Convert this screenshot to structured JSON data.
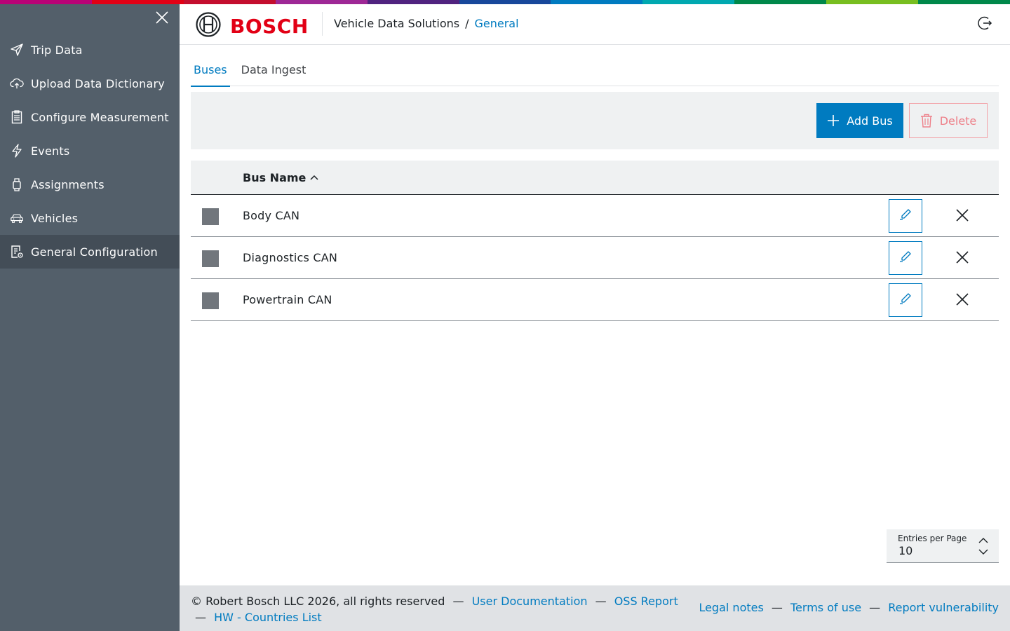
{
  "colors": {
    "accent": "#007bc0",
    "brand_red": "#e20015",
    "sidebar_bg": "#535f6a",
    "sidebar_active": "#434d57",
    "rainbow": [
      "#b90276",
      "#e20015",
      "#c40e2e",
      "#9e2896",
      "#50237f",
      "#18489b",
      "#007bc0",
      "#00a8b0",
      "#00884a",
      "#78be20",
      "#00884a"
    ]
  },
  "sidebar": {
    "close_icon": "close-icon",
    "items": [
      {
        "label": "Trip Data",
        "icon": "send-icon",
        "active": false
      },
      {
        "label": "Upload Data Dictionary",
        "icon": "cloud-upload-icon",
        "active": false
      },
      {
        "label": "Configure Measurement",
        "icon": "clipboard-list-icon",
        "active": false
      },
      {
        "label": "Events",
        "icon": "lightning-icon",
        "active": false
      },
      {
        "label": "Assignments",
        "icon": "watch-icon",
        "active": false
      },
      {
        "label": "Vehicles",
        "icon": "car-icon",
        "active": false
      },
      {
        "label": "General Configuration",
        "icon": "document-settings-icon",
        "active": true
      }
    ]
  },
  "header": {
    "logo_text": "BOSCH",
    "app_name": "Vehicle Data Solutions",
    "separator": "/",
    "current_page": "General",
    "logout_icon": "logout-icon"
  },
  "tabs": [
    {
      "label": "Buses",
      "active": true
    },
    {
      "label": "Data Ingest",
      "active": false
    }
  ],
  "toolbar": {
    "add_label": "Add Bus",
    "delete_label": "Delete"
  },
  "table": {
    "column_header": "Bus Name",
    "sort": "ascending",
    "rows": [
      {
        "name": "Body CAN"
      },
      {
        "name": "Diagnostics CAN"
      },
      {
        "name": "Powertrain CAN"
      }
    ]
  },
  "pagination": {
    "label": "Entries per Page",
    "value": "10"
  },
  "footer": {
    "copyright": "© Robert Bosch LLC 2026, all rights reserved",
    "dash": "—",
    "user_docs": "User Documentation",
    "oss_report": "OSS Report",
    "hw_countries": "HW - Countries List",
    "legal": "Legal notes",
    "terms": "Terms of use",
    "vulnerability": "Report vulnerability"
  }
}
